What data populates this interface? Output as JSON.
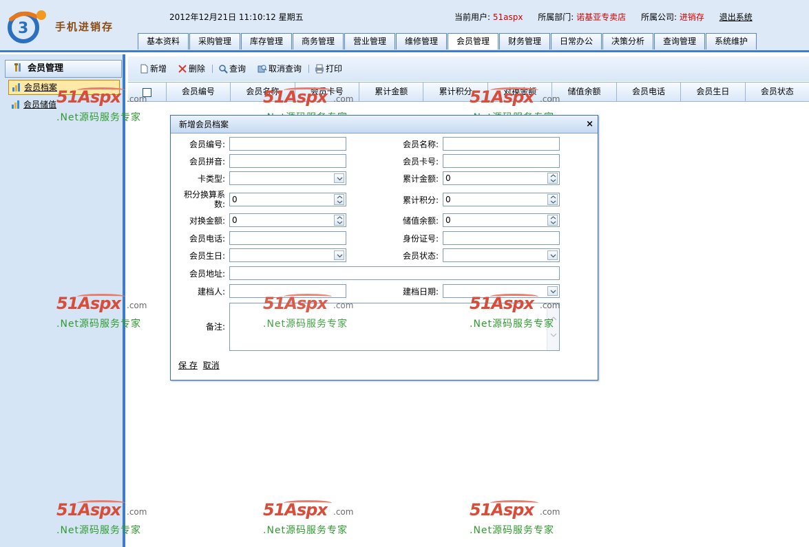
{
  "app": {
    "logo_text": "手机进销存",
    "datetime": "2012年12月21日 11:10:12 星期五"
  },
  "userbar": {
    "user_label": "当前用户:",
    "user_value": "51aspx",
    "dept_label": "所属部门:",
    "dept_value": "诺基亚专卖店",
    "company_label": "所属公司:",
    "company_value": "进销存",
    "logout": "退出系统"
  },
  "nav": {
    "tabs": [
      "基本资料",
      "采购管理",
      "库存管理",
      "商务管理",
      "营业管理",
      "维修管理",
      "会员管理",
      "财务管理",
      "日常办公",
      "决策分析",
      "查询管理",
      "系统维护"
    ],
    "active": "会员管理"
  },
  "sidebar": {
    "title": "会员管理",
    "items": [
      {
        "label": "会员档案"
      },
      {
        "label": "会员储值"
      }
    ]
  },
  "toolbar": {
    "new": "新增",
    "delete": "删除",
    "query": "查询",
    "cancel_query": "取消查询",
    "print": "打印"
  },
  "grid": {
    "columns": [
      "会员编号",
      "会员名称",
      "会员卡号",
      "累计金额",
      "累计积分",
      "对换金额",
      "储值余额",
      "会员电话",
      "会员生日",
      "会员状态"
    ]
  },
  "dialog": {
    "title": "新增会员档案",
    "close": "×",
    "fields": {
      "member_no": {
        "label": "会员编号:",
        "value": ""
      },
      "member_name": {
        "label": "会员名称:",
        "value": ""
      },
      "member_pinyin": {
        "label": "会员拼音:",
        "value": ""
      },
      "card_no": {
        "label": "会员卡号:",
        "value": ""
      },
      "card_type": {
        "label": "卡类型:",
        "value": ""
      },
      "total_amount": {
        "label": "累计金额:",
        "value": "0"
      },
      "points_ratio": {
        "label": "积分换算系数:",
        "value": "0"
      },
      "total_points": {
        "label": "累计积分:",
        "value": "0"
      },
      "exchange_amount": {
        "label": "对换金额:",
        "value": "0"
      },
      "stored_balance": {
        "label": "储值余额:",
        "value": "0"
      },
      "phone": {
        "label": "会员电话:",
        "value": ""
      },
      "id_card": {
        "label": "身份证号:",
        "value": ""
      },
      "birthday": {
        "label": "会员生日:",
        "value": ""
      },
      "status": {
        "label": "会员状态:",
        "value": ""
      },
      "address": {
        "label": "会员地址:",
        "value": ""
      },
      "creator": {
        "label": "建档人:",
        "value": ""
      },
      "create_date": {
        "label": "建档日期:",
        "value": ""
      },
      "remark": {
        "label": "备注:",
        "value": ""
      }
    },
    "save": "保 存",
    "cancel": "取消"
  },
  "watermark": {
    "brand": "51Aspx",
    "domain": ".com",
    "slogan": ".Net源码服务专家"
  },
  "icons": {
    "sidebar_head": "tools-icon",
    "member_record": "bar-chart-icon",
    "member_stored": "bar-chart-icon",
    "new": "document-icon",
    "delete": "delete-icon",
    "query": "magnifier-icon",
    "cancel_query": "cancel-search-icon",
    "print": "printer-icon"
  },
  "colors": {
    "accent": "#3d7cc9",
    "highlight_text": "#d40000",
    "sidebar_bg": "#d6e5f5",
    "header_bg": "#dde9f7"
  }
}
